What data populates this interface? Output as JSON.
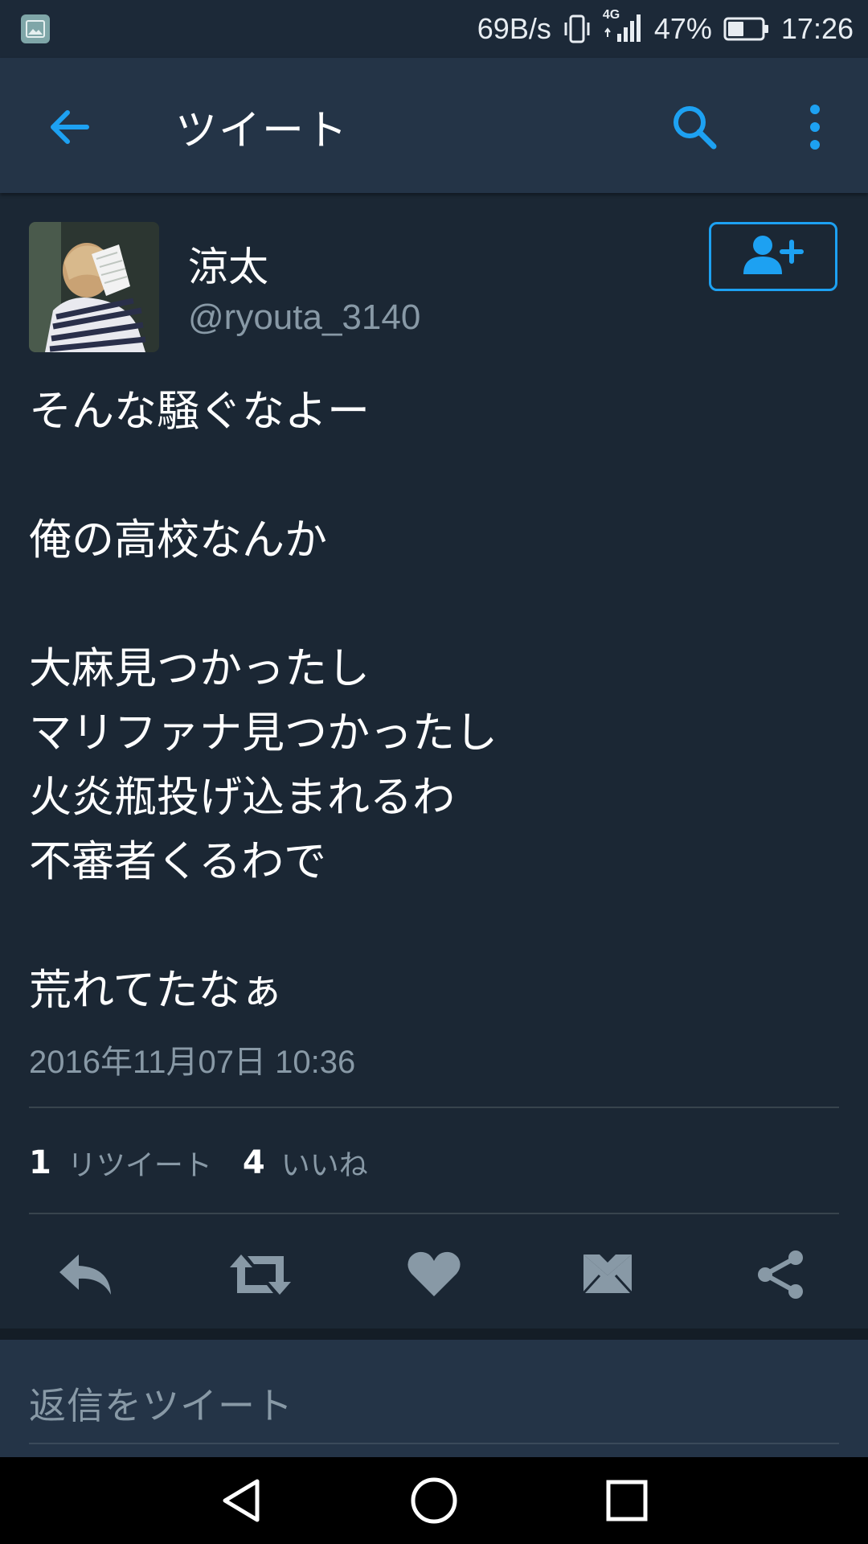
{
  "status_bar": {
    "net_speed": "69B/s",
    "network_type": "4G",
    "battery_percent": "47%",
    "battery_level": 0.47,
    "time": "17:26"
  },
  "app_bar": {
    "title": "ツイート",
    "back_icon": "arrow-left-icon",
    "search_icon": "search-icon",
    "more_icon": "more-vertical-icon"
  },
  "tweet": {
    "display_name": "涼太",
    "handle": "@ryouta_3140",
    "text": "そんな騒ぐなよー\n\n俺の高校なんか\n\n大麻見つかったし\nマリファナ見つかったし\n火炎瓶投げ込まれるわ\n不審者くるわで\n\n荒れてたなぁ",
    "timestamp": "2016年11月07日 10:36",
    "retweet_count": "1",
    "retweet_label": "リツイート",
    "like_count": "4",
    "like_label": "いいね"
  },
  "actions": {
    "reply": "reply-icon",
    "retweet": "retweet-icon",
    "like": "heart-icon",
    "dm": "mail-icon",
    "share": "share-icon"
  },
  "reply_bar": {
    "placeholder": "返信をツイート"
  },
  "colors": {
    "background": "#1b2734",
    "app_bar": "#243447",
    "accent": "#1da1f2",
    "secondary_text": "#8899a6",
    "action_icon": "#8899a6"
  }
}
